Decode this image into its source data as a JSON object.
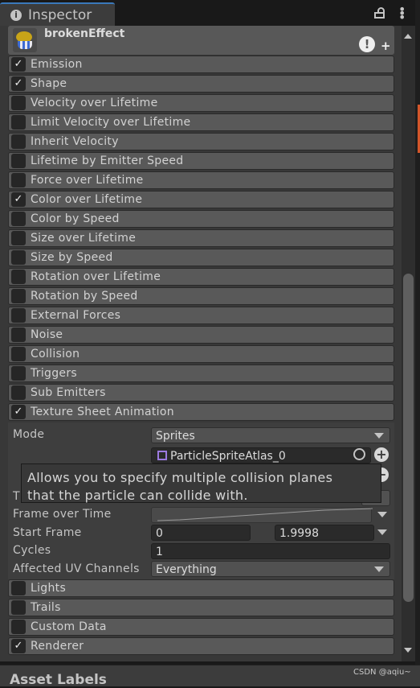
{
  "tab": {
    "title": "Inspector",
    "info_icon": "info-icon",
    "lock_icon": "lock-icon",
    "menu_icon": "kebab-menu-icon"
  },
  "header": {
    "name": "brokenEffect",
    "warning_icon": "warning-icon",
    "add_icon": "plus-icon"
  },
  "modules": [
    {
      "label": "Emission",
      "checked": true
    },
    {
      "label": "Shape",
      "checked": true
    },
    {
      "label": "Velocity over Lifetime",
      "checked": false
    },
    {
      "label": "Limit Velocity over Lifetime",
      "checked": false
    },
    {
      "label": "Inherit Velocity",
      "checked": false
    },
    {
      "label": "Lifetime by Emitter Speed",
      "checked": false
    },
    {
      "label": "Force over Lifetime",
      "checked": false
    },
    {
      "label": "Color over Lifetime",
      "checked": true
    },
    {
      "label": "Color by Speed",
      "checked": false
    },
    {
      "label": "Size over Lifetime",
      "checked": false
    },
    {
      "label": "Size by Speed",
      "checked": false
    },
    {
      "label": "Rotation over Lifetime",
      "checked": false
    },
    {
      "label": "Rotation by Speed",
      "checked": false
    },
    {
      "label": "External Forces",
      "checked": false
    },
    {
      "label": "Noise",
      "checked": false
    },
    {
      "label": "Collision",
      "checked": false
    },
    {
      "label": "Triggers",
      "checked": false
    },
    {
      "label": "Sub Emitters",
      "checked": false
    },
    {
      "label": "Texture Sheet Animation",
      "checked": true
    }
  ],
  "texture_sheet": {
    "mode_label": "Mode",
    "mode_value": "Sprites",
    "sprite_value": "ParticleSpriteAtlas_0",
    "time_mode_label_partial": "T",
    "frame_over_time_label": "Frame over Time",
    "start_frame_label": "Start Frame",
    "start_frame_min": "0",
    "start_frame_max": "1.9998",
    "cycles_label": "Cycles",
    "cycles_value": "1",
    "uv_label": "Affected UV Channels",
    "uv_value": "Everything"
  },
  "tooltip": {
    "line1": "Allows you to specify multiple collision planes",
    "line2": "that the particle can collide with."
  },
  "modules_after": [
    {
      "label": "Lights",
      "checked": false
    },
    {
      "label": "Trails",
      "checked": false
    },
    {
      "label": "Custom Data",
      "checked": false
    },
    {
      "label": "Renderer",
      "checked": true
    }
  ],
  "footer": {
    "title": "Asset Labels",
    "watermark": "CSDN @aqiu~"
  }
}
